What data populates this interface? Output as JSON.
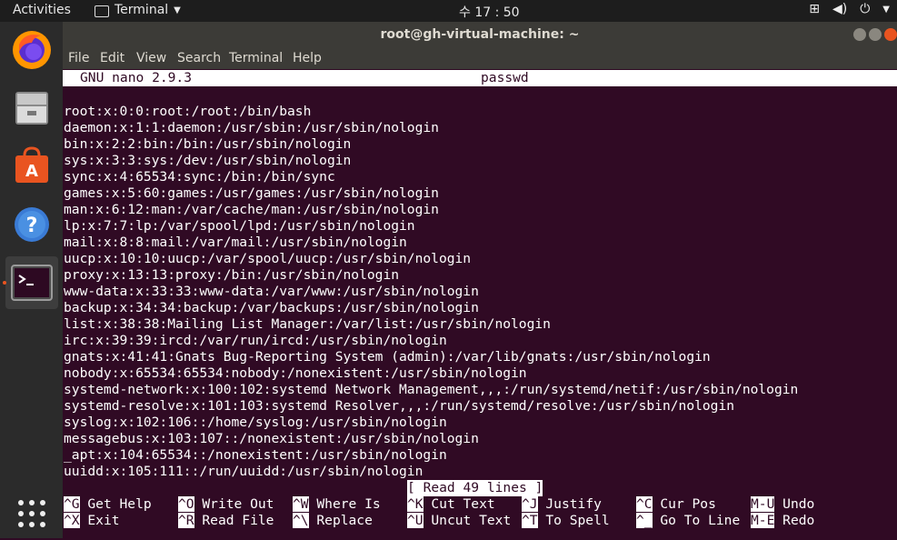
{
  "topbar": {
    "activities": "Activities",
    "app_name": "Terminal",
    "clock": "수 17 : 50"
  },
  "window": {
    "title": "root@gh-virtual-machine: ~",
    "menu": [
      "File",
      "Edit",
      "View",
      "Search",
      "Terminal",
      "Help"
    ]
  },
  "nano": {
    "version": "GNU nano 2.9.3",
    "filename": "passwd",
    "status": "[ Read 49 lines ]",
    "lines": [
      "root:x:0:0:root:/root:/bin/bash",
      "daemon:x:1:1:daemon:/usr/sbin:/usr/sbin/nologin",
      "bin:x:2:2:bin:/bin:/usr/sbin/nologin",
      "sys:x:3:3:sys:/dev:/usr/sbin/nologin",
      "sync:x:4:65534:sync:/bin:/bin/sync",
      "games:x:5:60:games:/usr/games:/usr/sbin/nologin",
      "man:x:6:12:man:/var/cache/man:/usr/sbin/nologin",
      "lp:x:7:7:lp:/var/spool/lpd:/usr/sbin/nologin",
      "mail:x:8:8:mail:/var/mail:/usr/sbin/nologin",
      "uucp:x:10:10:uucp:/var/spool/uucp:/usr/sbin/nologin",
      "proxy:x:13:13:proxy:/bin:/usr/sbin/nologin",
      "www-data:x:33:33:www-data:/var/www:/usr/sbin/nologin",
      "backup:x:34:34:backup:/var/backups:/usr/sbin/nologin",
      "list:x:38:38:Mailing List Manager:/var/list:/usr/sbin/nologin",
      "irc:x:39:39:ircd:/var/run/ircd:/usr/sbin/nologin",
      "gnats:x:41:41:Gnats Bug-Reporting System (admin):/var/lib/gnats:/usr/sbin/nologin",
      "nobody:x:65534:65534:nobody:/nonexistent:/usr/sbin/nologin",
      "systemd-network:x:100:102:systemd Network Management,,,:/run/systemd/netif:/usr/sbin/nologin",
      "systemd-resolve:x:101:103:systemd Resolver,,,:/run/systemd/resolve:/usr/sbin/nologin",
      "syslog:x:102:106::/home/syslog:/usr/sbin/nologin",
      "messagebus:x:103:107::/nonexistent:/usr/sbin/nologin",
      "_apt:x:104:65534::/nonexistent:/usr/sbin/nologin",
      "uuidd:x:105:111::/run/uuidd:/usr/sbin/nologin"
    ],
    "shortcuts": [
      {
        "key": "^G",
        "label": "Get Help"
      },
      {
        "key": "^O",
        "label": "Write Out"
      },
      {
        "key": "^W",
        "label": "Where Is"
      },
      {
        "key": "^K",
        "label": "Cut Text"
      },
      {
        "key": "^J",
        "label": "Justify"
      },
      {
        "key": "^C",
        "label": "Cur Pos"
      },
      {
        "key": "M-U",
        "label": "Undo"
      },
      {
        "key": "^X",
        "label": "Exit"
      },
      {
        "key": "^R",
        "label": "Read File"
      },
      {
        "key": "^\\",
        "label": "Replace"
      },
      {
        "key": "^U",
        "label": "Uncut Text"
      },
      {
        "key": "^T",
        "label": "To Spell"
      },
      {
        "key": "^_",
        "label": "Go To Line"
      },
      {
        "key": "M-E",
        "label": "Redo"
      }
    ]
  },
  "colors": {
    "terminal_bg": "#300a24",
    "accent": "#e95420"
  },
  "dock_icons": [
    "firefox-icon",
    "files-icon",
    "software-icon",
    "help-icon",
    "terminal-icon",
    "show-apps-icon"
  ]
}
